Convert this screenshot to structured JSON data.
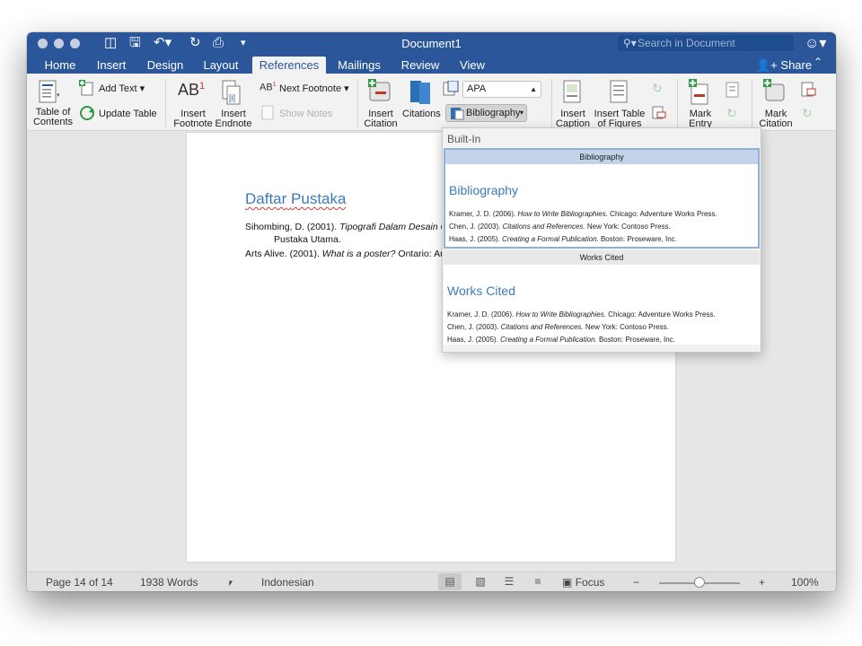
{
  "window": {
    "title": "Document1",
    "search_placeholder": "Search in Document",
    "tabs": [
      "Home",
      "Insert",
      "Design",
      "Layout",
      "References",
      "Mailings",
      "Review",
      "View"
    ],
    "active_tab": "References",
    "share_label": "Share"
  },
  "ribbon": {
    "toc_label_1": "Table of",
    "toc_label_2": "Contents",
    "add_text": "Add Text",
    "update_table": "Update Table",
    "insert_footnote_1": "Insert",
    "insert_footnote_2": "Footnote",
    "insert_endnote_1": "Insert",
    "insert_endnote_2": "Endnote",
    "next_footnote": "Next Footnote",
    "show_notes": "Show Notes",
    "insert_citation_1": "Insert",
    "insert_citation_2": "Citation",
    "citations": "Citations",
    "style_value": "APA",
    "bibliography": "Bibliography",
    "insert_caption_1": "Insert",
    "insert_caption_2": "Caption",
    "insert_tof_1": "Insert Table",
    "insert_tof_2": "of Figures",
    "mark_entry_1": "Mark",
    "mark_entry_2": "Entry",
    "mark_citation_1": "Mark",
    "mark_citation_2": "Citation",
    "footnote_glyph": "AB",
    "footnote_sup": "1",
    "next_footnote_glyph": "AB",
    "next_footnote_sup": "1"
  },
  "document": {
    "heading_word1": "Daftar",
    "heading_word2": "Pustaka",
    "refs": [
      {
        "pre": "Sihombing, D. (2001). ",
        "italic": "Tipografi Dalam Desain Gra",
        "post": ""
      },
      {
        "pre": "Pustaka Utama.",
        "italic": "",
        "post": ""
      },
      {
        "pre": "Arts Alive. (2001). ",
        "italic": "What is a poster?",
        "post": " Ontario: Arts"
      }
    ]
  },
  "dropdown": {
    "section": "Built-In",
    "items": [
      {
        "title": "Bibliography",
        "heading": "Bibliography",
        "lines": [
          {
            "pre": "Kramer, J. D. (2006). ",
            "italic": "How to Write Bibliographies.",
            "post": " Chicago: Adventure Works Press."
          },
          {
            "pre": "Chen, J. (2003). ",
            "italic": "Citations and References.",
            "post": " New York: Contoso Press."
          },
          {
            "pre": "Haas, J. (2005). ",
            "italic": "Creating a Formal Publication.",
            "post": " Boston: Proseware, Inc."
          }
        ]
      },
      {
        "title": "Works Cited",
        "heading": "Works Cited",
        "lines": [
          {
            "pre": "Kramer, J. D. (2006). ",
            "italic": "How to Write Bibliographies.",
            "post": " Chicago: Adventure Works Press."
          },
          {
            "pre": "Chen, J. (2003). ",
            "italic": "Citations and References.",
            "post": " New York: Contoso Press."
          },
          {
            "pre": "Haas, J. (2005). ",
            "italic": "Creating a Formal Publication.",
            "post": " Boston: Proseware, Inc."
          }
        ]
      }
    ]
  },
  "status": {
    "page": "Page 14 of 14",
    "words": "1938 Words",
    "language": "Indonesian",
    "focus": "Focus",
    "zoom_minus": "−",
    "zoom_plus": "+",
    "zoom_level": "100%",
    "zoom_fraction": 0.5
  },
  "colors": {
    "title_bar": "#2b579a",
    "heading_blue": "#3c7ab8",
    "selected_item": "#c3d4ea"
  }
}
